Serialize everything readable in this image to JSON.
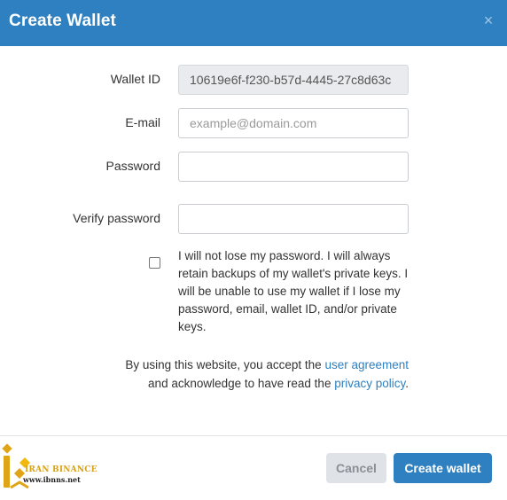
{
  "dialog": {
    "title": "Create Wallet",
    "close_symbol": "×"
  },
  "form": {
    "wallet_id": {
      "label": "Wallet ID",
      "value": "10619e6f-f230-b57d-4445-27c8d63c"
    },
    "email": {
      "label": "E-mail",
      "placeholder": "example@domain.com",
      "value": ""
    },
    "password": {
      "label": "Password",
      "value": ""
    },
    "verify_password": {
      "label": "Verify password",
      "value": ""
    },
    "agreement": {
      "checked": false,
      "text": "I will not lose my password. I will always retain backups of my wallet's private keys. I will be unable to use my wallet if I lose my password, email, wallet ID, and/or private keys."
    }
  },
  "terms": {
    "prefix": "By using this website, you accept the ",
    "user_agreement_link": "user agreement",
    "middle": "and acknowledge to have read the ",
    "privacy_policy_link": "privacy policy",
    "suffix": "."
  },
  "footer": {
    "cancel_label": "Cancel",
    "create_label": "Create wallet"
  },
  "watermark": {
    "brand": "IRAN BINANCE",
    "url": "www.ibnns.net"
  },
  "colors": {
    "primary": "#2f80c0",
    "cancel_bg": "#dfe3e7",
    "logo_gold": "#d9a214"
  }
}
